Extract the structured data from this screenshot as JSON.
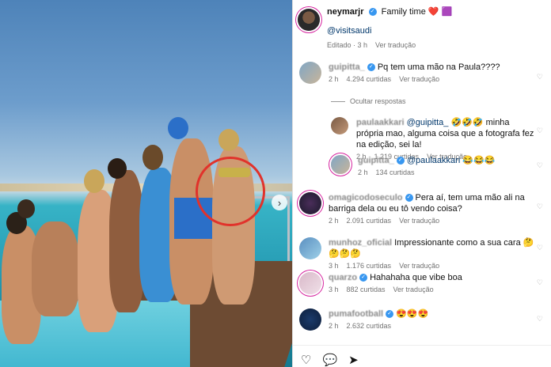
{
  "post": {
    "username": "neymarjr",
    "caption": "Family time",
    "caption_emojis": "❤️ 🟪",
    "mention": "@visitsaudi",
    "edited": "Editado · 3 h",
    "translate": "Ver tradução"
  },
  "comments": [
    {
      "user": "guipitta_",
      "text": "Pq tem uma mão na Paula????",
      "time": "2 h",
      "likes": "4.294 curtidas",
      "translate": "Ver tradução"
    },
    {
      "user": "paulaakkari",
      "mention": "@guipitta_",
      "text": "🤣🤣🤣 minha própria mao, alguma coisa que a fotografa fez na edição, sei la!",
      "time": "2 h",
      "likes": "1.219 curtidas",
      "translate": "Ver tradução"
    },
    {
      "user": "guipitta_",
      "mention": "@paulaakkari",
      "text": "😂😂😂",
      "time": "2 h",
      "likes": "134 curtidas"
    },
    {
      "user": "omagicodoseculo",
      "text": "Pera aí, tem uma mão ali na barriga dela ou eu tô vendo coisa?",
      "time": "2 h",
      "likes": "2.091 curtidas",
      "translate": "Ver tradução"
    },
    {
      "user": "munhoz_oficial",
      "text": "Impressionante como a sua cara 🤔🤔🤔🤔",
      "time": "3 h",
      "likes": "1.176 curtidas",
      "translate": "Ver tradução"
    },
    {
      "user": "quarzo",
      "text": "Hahahaha que vibe boa",
      "time": "3 h",
      "likes": "882 curtidas",
      "translate": "Ver tradução"
    },
    {
      "user": "pumafootball",
      "text": "😍😍😍",
      "time": "2 h",
      "likes": "2.632 curtidas"
    }
  ],
  "hide_replies": "Ocultar respostas",
  "icons": {
    "like": "heart-icon",
    "comment": "comment-icon",
    "share": "share-icon",
    "next": "chevron-right-icon"
  },
  "colors": {
    "verified": "#3897f0",
    "highlight": "#e1322b"
  }
}
